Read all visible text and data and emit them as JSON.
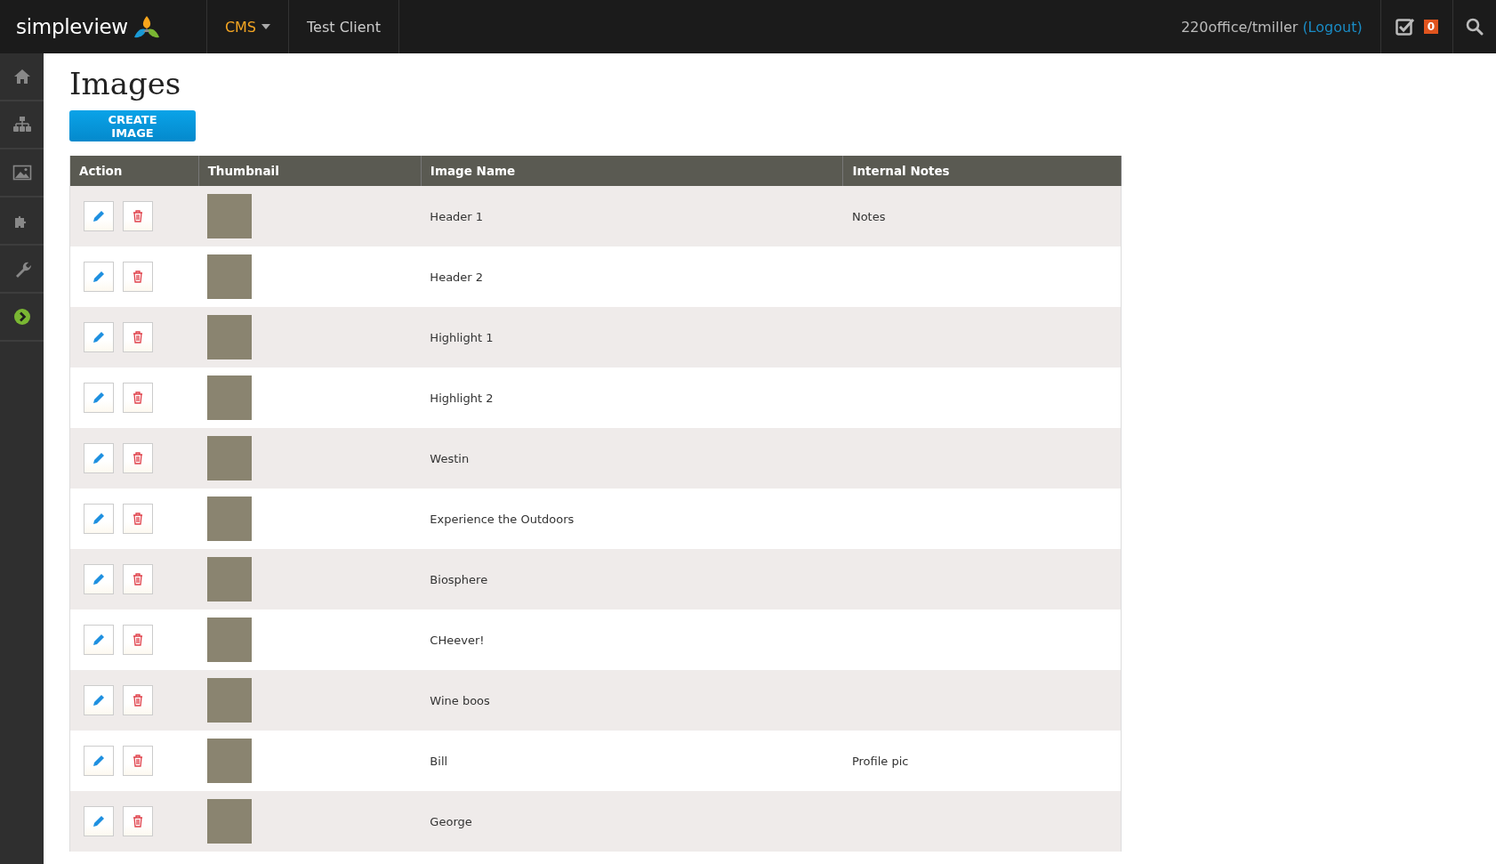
{
  "topbar": {
    "brand": "simpleview",
    "nav": [
      {
        "label": "CMS",
        "kind": "dropdown"
      },
      {
        "label": "Test Client",
        "kind": "link"
      }
    ],
    "user": "220office/tmiller",
    "logout": "(Logout)",
    "task_count": "0"
  },
  "page": {
    "title": "Images",
    "create_button": "CREATE IMAGE"
  },
  "table": {
    "columns": [
      "Action",
      "Thumbnail",
      "Image Name",
      "Internal Notes"
    ],
    "rows": [
      {
        "name": "Header 1",
        "notes": "Notes"
      },
      {
        "name": "Header 2"
      },
      {
        "name": "Highlight 1"
      },
      {
        "name": "Highlight 2"
      },
      {
        "name": "Westin"
      },
      {
        "name": "Experience the Outdoors"
      },
      {
        "name": "Biosphere"
      },
      {
        "name": "CHeever!"
      },
      {
        "name": "Wine boos"
      },
      {
        "name": "Bill",
        "notes": "Profile pic"
      },
      {
        "name": "George"
      }
    ]
  }
}
